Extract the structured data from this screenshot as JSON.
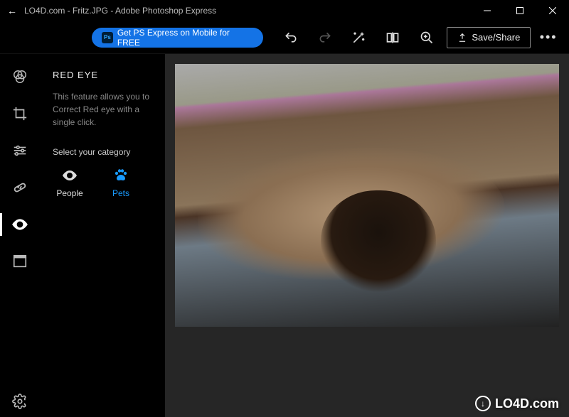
{
  "titlebar": {
    "title": "LO4D.com - Fritz.JPG - Adobe Photoshop Express"
  },
  "topbar": {
    "promo_label": "Get PS Express on Mobile for FREE",
    "save_label": "Save/Share"
  },
  "sidebar": {
    "items": [
      {
        "name": "looks-icon"
      },
      {
        "name": "crop-icon"
      },
      {
        "name": "adjustments-icon"
      },
      {
        "name": "spot-heal-icon"
      },
      {
        "name": "eye-icon",
        "active": true
      },
      {
        "name": "borders-icon"
      }
    ],
    "settings_label": "settings-icon"
  },
  "panel": {
    "title": "RED EYE",
    "description": "This feature allows you to Correct Red eye with a single click.",
    "section_label": "Select your category",
    "categories": [
      {
        "label": "People",
        "icon": "eye-icon",
        "selected": false
      },
      {
        "label": "Pets",
        "icon": "paw-icon",
        "selected": true
      }
    ]
  },
  "watermark": {
    "text": "LO4D.com"
  }
}
